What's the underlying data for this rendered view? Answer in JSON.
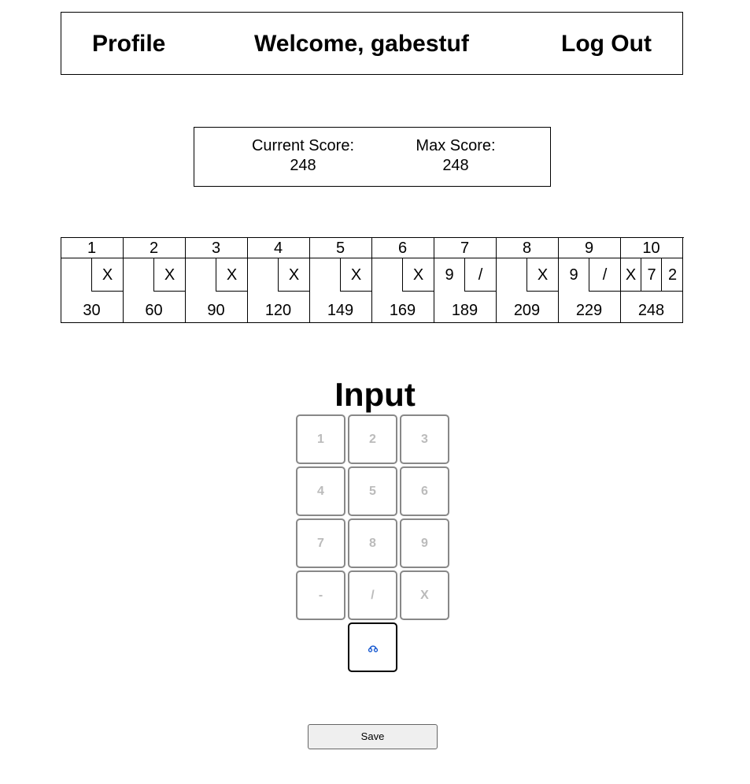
{
  "header": {
    "profile_label": "Profile",
    "welcome_text": "Welcome, gabestuf",
    "logout_label": "Log Out"
  },
  "scores": {
    "current_label": "Current Score:",
    "current_value": "248",
    "max_label": "Max Score:",
    "max_value": "248"
  },
  "scorecard": {
    "frames": [
      {
        "number": "1",
        "rolls": [
          "",
          "X"
        ],
        "total": "30"
      },
      {
        "number": "2",
        "rolls": [
          "",
          "X"
        ],
        "total": "60"
      },
      {
        "number": "3",
        "rolls": [
          "",
          "X"
        ],
        "total": "90"
      },
      {
        "number": "4",
        "rolls": [
          "",
          "X"
        ],
        "total": "120"
      },
      {
        "number": "5",
        "rolls": [
          "",
          "X"
        ],
        "total": "149"
      },
      {
        "number": "6",
        "rolls": [
          "",
          "X"
        ],
        "total": "169"
      },
      {
        "number": "7",
        "rolls": [
          "9",
          "/"
        ],
        "total": "189"
      },
      {
        "number": "8",
        "rolls": [
          "",
          "X"
        ],
        "total": "209"
      },
      {
        "number": "9",
        "rolls": [
          "9",
          "/"
        ],
        "total": "229"
      },
      {
        "number": "10",
        "rolls": [
          "X",
          "7",
          "2"
        ],
        "total": "248"
      }
    ]
  },
  "input": {
    "title": "Input",
    "keys": [
      "1",
      "2",
      "3",
      "4",
      "5",
      "6",
      "7",
      "8",
      "9",
      "-",
      "/",
      "X"
    ],
    "undo_icon": "undo-icon",
    "undo_color": "#1a5bd1"
  },
  "save_label": "Save"
}
